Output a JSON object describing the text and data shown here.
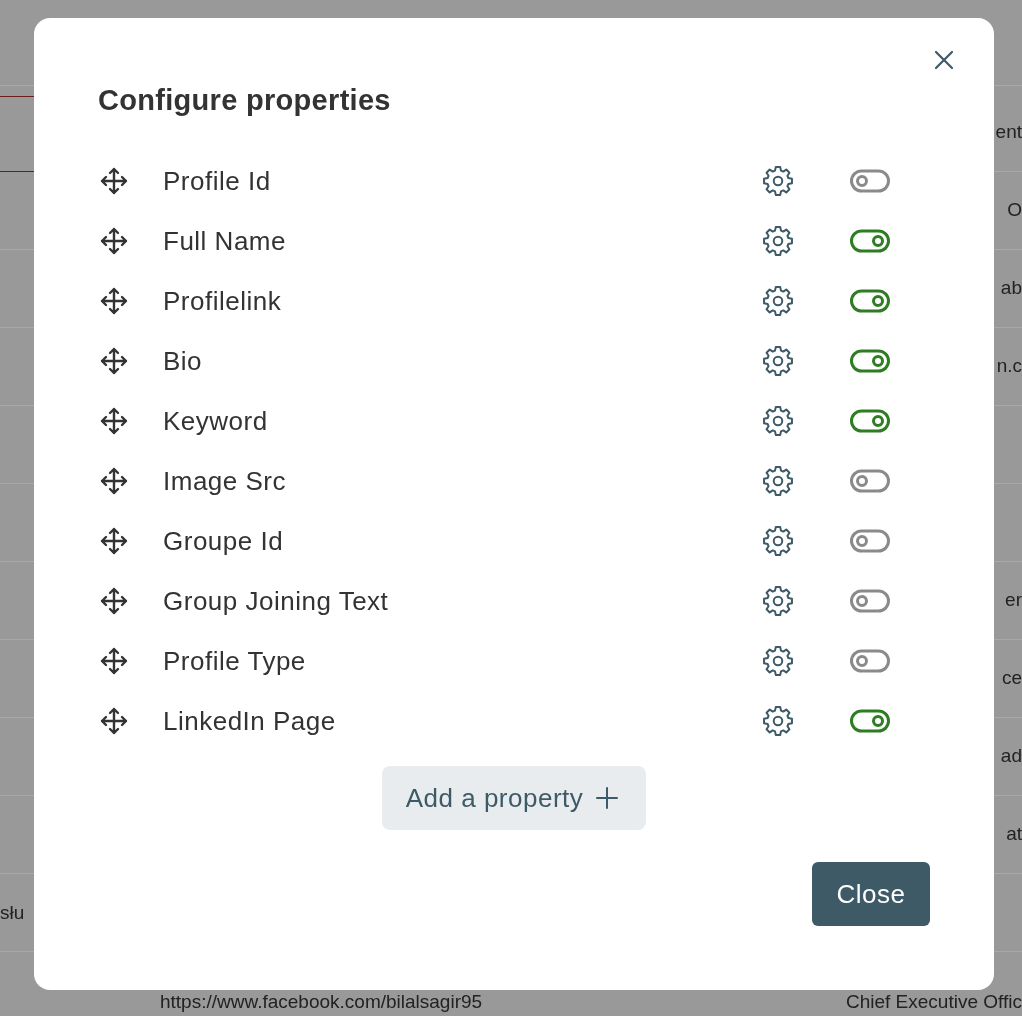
{
  "background_table": {
    "rows": [
      {
        "input_field": {
          "invalid": true
        },
        "column_3": "ent"
      },
      {
        "column_3": "O"
      },
      {
        "column_3": "ab"
      },
      {
        "column_3": "n.c"
      },
      {},
      {},
      {
        "column_3": "er"
      },
      {
        "column_3": "ce"
      },
      {
        "column_3": "ad"
      },
      {
        "column_3": "at"
      },
      {
        "column_1": "słu"
      },
      {
        "column_2": "https://www.facebook.com/bilalsagir95",
        "column_3": "Chief Executive Offic"
      }
    ]
  },
  "dialog": {
    "title": "Configure properties",
    "properties": [
      {
        "label": "Profile Id",
        "enabled": false
      },
      {
        "label": "Full Name",
        "enabled": true
      },
      {
        "label": "Profilelink",
        "enabled": true
      },
      {
        "label": "Bio",
        "enabled": true
      },
      {
        "label": "Keyword",
        "enabled": true
      },
      {
        "label": "Image Src",
        "enabled": false
      },
      {
        "label": "Groupe Id",
        "enabled": false
      },
      {
        "label": "Group Joining Text",
        "enabled": false
      },
      {
        "label": "Profile Type",
        "enabled": false
      },
      {
        "label": "LinkedIn Page",
        "enabled": true
      }
    ],
    "add_button": "Add a property",
    "close_button": "Close"
  }
}
